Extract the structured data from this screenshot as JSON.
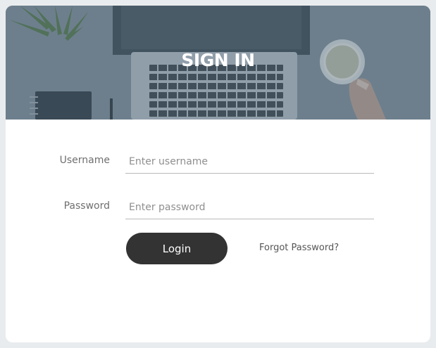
{
  "header": {
    "title": "SIGN IN"
  },
  "form": {
    "username": {
      "label": "Username",
      "placeholder": "Enter username",
      "value": ""
    },
    "password": {
      "label": "Password",
      "placeholder": "Enter password",
      "value": ""
    },
    "login_label": "Login",
    "forgot_label": "Forgot Password?"
  },
  "colors": {
    "page_background": "#e9ecee",
    "card_background": "#ffffff",
    "button_background": "#333333",
    "button_text": "#ffffff",
    "header_overlay": "#4a6070"
  }
}
